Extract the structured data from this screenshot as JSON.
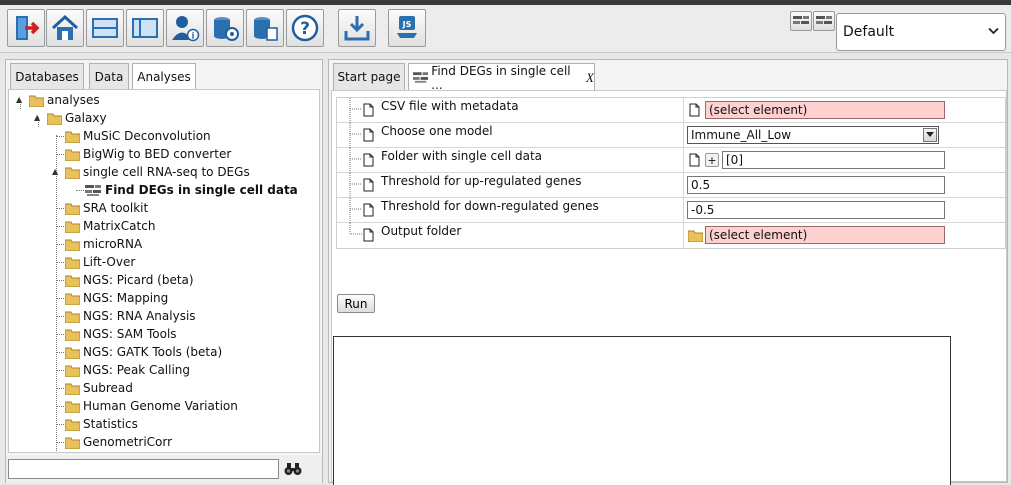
{
  "toolbar": {
    "buttons": [
      "exit-icon",
      "home-icon",
      "layout-horizontal-icon",
      "layout-vertical-icon",
      "user-info-icon",
      "database-settings-icon",
      "database-copy-icon",
      "help-icon",
      "download-icon",
      "javascript-icon"
    ],
    "perspective": {
      "selected": "Default"
    }
  },
  "left_panel": {
    "tabs": [
      {
        "label": "Databases",
        "active": false
      },
      {
        "label": "Data",
        "active": false
      },
      {
        "label": "Analyses",
        "active": true
      }
    ],
    "tree": [
      {
        "label": "analyses",
        "level": 0,
        "type": "folder"
      },
      {
        "label": "Galaxy",
        "level": 1,
        "type": "folder"
      },
      {
        "label": "MuSiC Deconvolution",
        "level": 2,
        "type": "folder"
      },
      {
        "label": "BigWig to BED converter",
        "level": 2,
        "type": "folder"
      },
      {
        "label": "single cell RNA-seq to DEGs",
        "level": 2,
        "type": "folder"
      },
      {
        "label": "Find DEGs in single cell data",
        "level": 3,
        "type": "tool"
      },
      {
        "label": "SRA toolkit",
        "level": 2,
        "type": "folder"
      },
      {
        "label": "MatrixCatch",
        "level": 2,
        "type": "folder"
      },
      {
        "label": "microRNA",
        "level": 2,
        "type": "folder"
      },
      {
        "label": "Lift-Over",
        "level": 2,
        "type": "folder"
      },
      {
        "label": "NGS: Picard (beta)",
        "level": 2,
        "type": "folder"
      },
      {
        "label": "NGS: Mapping",
        "level": 2,
        "type": "folder"
      },
      {
        "label": "NGS: RNA Analysis",
        "level": 2,
        "type": "folder"
      },
      {
        "label": "NGS: SAM Tools",
        "level": 2,
        "type": "folder"
      },
      {
        "label": "NGS: GATK Tools (beta)",
        "level": 2,
        "type": "folder"
      },
      {
        "label": "NGS: Peak Calling",
        "level": 2,
        "type": "folder"
      },
      {
        "label": "Subread",
        "level": 2,
        "type": "folder"
      },
      {
        "label": "Human Genome Variation",
        "level": 2,
        "type": "folder"
      },
      {
        "label": "Statistics",
        "level": 2,
        "type": "folder"
      },
      {
        "label": "GenometriCorr",
        "level": 2,
        "type": "folder"
      }
    ],
    "search": {
      "value": "",
      "icon": "binoculars-icon"
    }
  },
  "right_panel": {
    "tabs": {
      "start": "Start page",
      "tool": "Find DEGs in single cell ...",
      "close": "X"
    },
    "params": [
      {
        "label": "CSV file with metadata",
        "value": "(select element)",
        "kind": "element"
      },
      {
        "label": "Choose one model",
        "value": "Immune_All_Low",
        "kind": "select"
      },
      {
        "label": "Folder with single cell data",
        "value": "[0]",
        "kind": "list"
      },
      {
        "label": "Threshold for up-regulated genes",
        "value": "0.5",
        "kind": "text"
      },
      {
        "label": "Threshold for down-regulated genes",
        "value": "-0.5",
        "kind": "text"
      },
      {
        "label": "Output folder",
        "value": "(select element)",
        "kind": "folder"
      }
    ],
    "list_add": "+",
    "run_label": "Run"
  },
  "colors": {
    "invalid_field": "#ffd0d0",
    "folder": "#e8c15a",
    "toolbar_icon": "#2a6fb0"
  }
}
